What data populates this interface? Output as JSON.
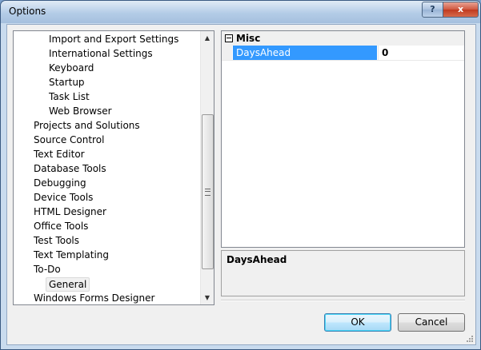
{
  "window": {
    "title": "Options",
    "help_glyph": "?",
    "close_glyph": "x"
  },
  "tree": {
    "items": [
      {
        "label": "Import and Export Settings",
        "level": 2
      },
      {
        "label": "International Settings",
        "level": 2
      },
      {
        "label": "Keyboard",
        "level": 2
      },
      {
        "label": "Startup",
        "level": 2
      },
      {
        "label": "Task List",
        "level": 2
      },
      {
        "label": "Web Browser",
        "level": 2
      },
      {
        "label": "Projects and Solutions",
        "level": 1
      },
      {
        "label": "Source Control",
        "level": 1
      },
      {
        "label": "Text Editor",
        "level": 1
      },
      {
        "label": "Database Tools",
        "level": 1
      },
      {
        "label": "Debugging",
        "level": 1
      },
      {
        "label": "Device Tools",
        "level": 1
      },
      {
        "label": "HTML Designer",
        "level": 1
      },
      {
        "label": "Office Tools",
        "level": 1
      },
      {
        "label": "Test Tools",
        "level": 1
      },
      {
        "label": "Text Templating",
        "level": 1
      },
      {
        "label": "To-Do",
        "level": 1
      },
      {
        "label": "General",
        "level": 2,
        "selected": true
      },
      {
        "label": "Windows Forms Designer",
        "level": 1
      }
    ]
  },
  "property_grid": {
    "category": "Misc",
    "property_name": "DaysAhead",
    "property_value": "0"
  },
  "help_pane": {
    "title": "DaysAhead"
  },
  "buttons": {
    "ok": "OK",
    "cancel": "Cancel"
  },
  "colors": {
    "selection": "#3399ff",
    "window_frame": "#b9d1ea"
  }
}
